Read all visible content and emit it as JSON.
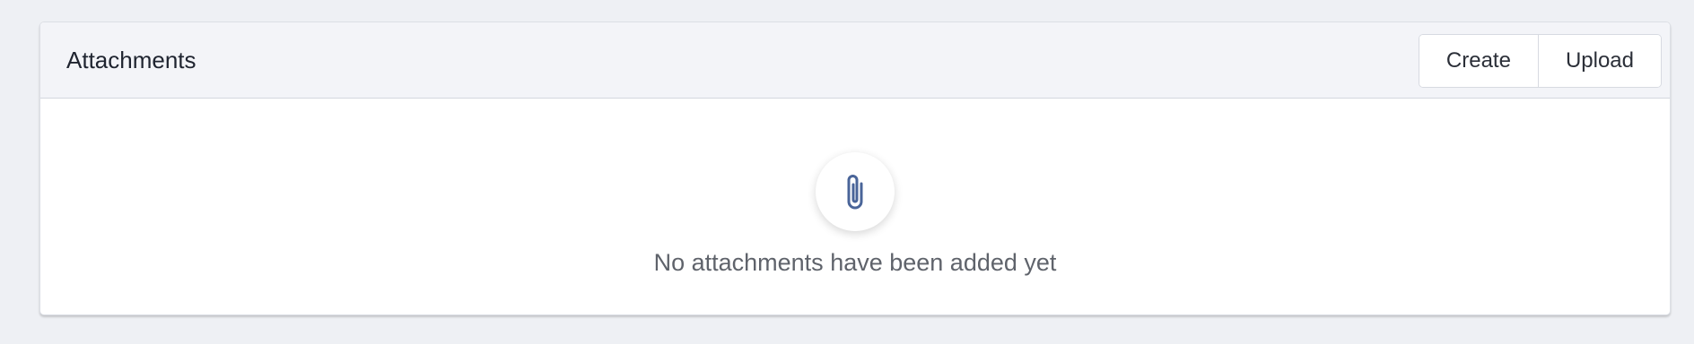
{
  "panel": {
    "title": "Attachments",
    "actions": {
      "create_label": "Create",
      "upload_label": "Upload"
    }
  },
  "empty_state": {
    "icon": "paperclip-icon",
    "message": "No attachments have been added yet"
  },
  "colors": {
    "page_background": "#eef0f4",
    "header_background": "#f3f4f8",
    "icon_accent": "#4a6599"
  }
}
